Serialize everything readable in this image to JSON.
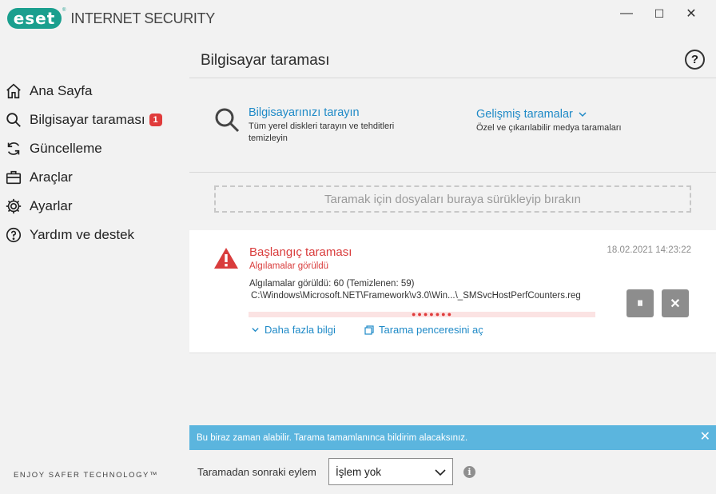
{
  "app": {
    "logo_text": "eset",
    "product": "INTERNET SECURITY"
  },
  "window_controls": {
    "minimize": "—",
    "maximize": "☐",
    "close": "✕"
  },
  "sidebar": {
    "items": [
      {
        "label": "Ana Sayfa",
        "icon": "home-icon"
      },
      {
        "label": "Bilgisayar taraması",
        "icon": "search-icon",
        "badge": "1"
      },
      {
        "label": "Güncelleme",
        "icon": "refresh-icon"
      },
      {
        "label": "Araçlar",
        "icon": "briefcase-icon"
      },
      {
        "label": "Ayarlar",
        "icon": "gear-icon"
      },
      {
        "label": "Yardım ve destek",
        "icon": "help-icon"
      }
    ],
    "tagline": "ENJOY SAFER TECHNOLOGY™"
  },
  "main": {
    "title": "Bilgisayar taraması",
    "help": "?",
    "scan_pc": {
      "title": "Bilgisayarınızı tarayın",
      "line1": "Tüm yerel diskleri tarayın ve tehditleri",
      "line2": "temizleyin"
    },
    "advanced": {
      "title": "Gelişmiş taramalar",
      "sub": "Özel ve çıkarılabilir medya taramaları"
    },
    "dropzone": "Taramak için dosyaları buraya sürükleyip bırakın",
    "scan": {
      "title": "Başlangıç taraması",
      "status": "Algılamalar görüldü",
      "date": "18.02.2021 14:23:22",
      "detections": "Algılamalar görüldü: 60 (Temizlenen: 59)",
      "path": "C:\\Windows\\Microsoft.NET\\Framework\\v3.0\\Win...\\_SMSvcHostPerfCounters.reg",
      "more_info": "Daha fazla bilgi",
      "open_window": "Tarama penceresini aç",
      "pause": "⏸",
      "stop": "✕"
    },
    "infobar": {
      "text": "Bu biraz zaman alabilir. Tarama tamamlanınca bildirim alacaksınız.",
      "close": "✕"
    },
    "after_scan": {
      "label": "Taramadan sonraki eylem",
      "selected": "İşlem yok",
      "info": "i"
    }
  }
}
